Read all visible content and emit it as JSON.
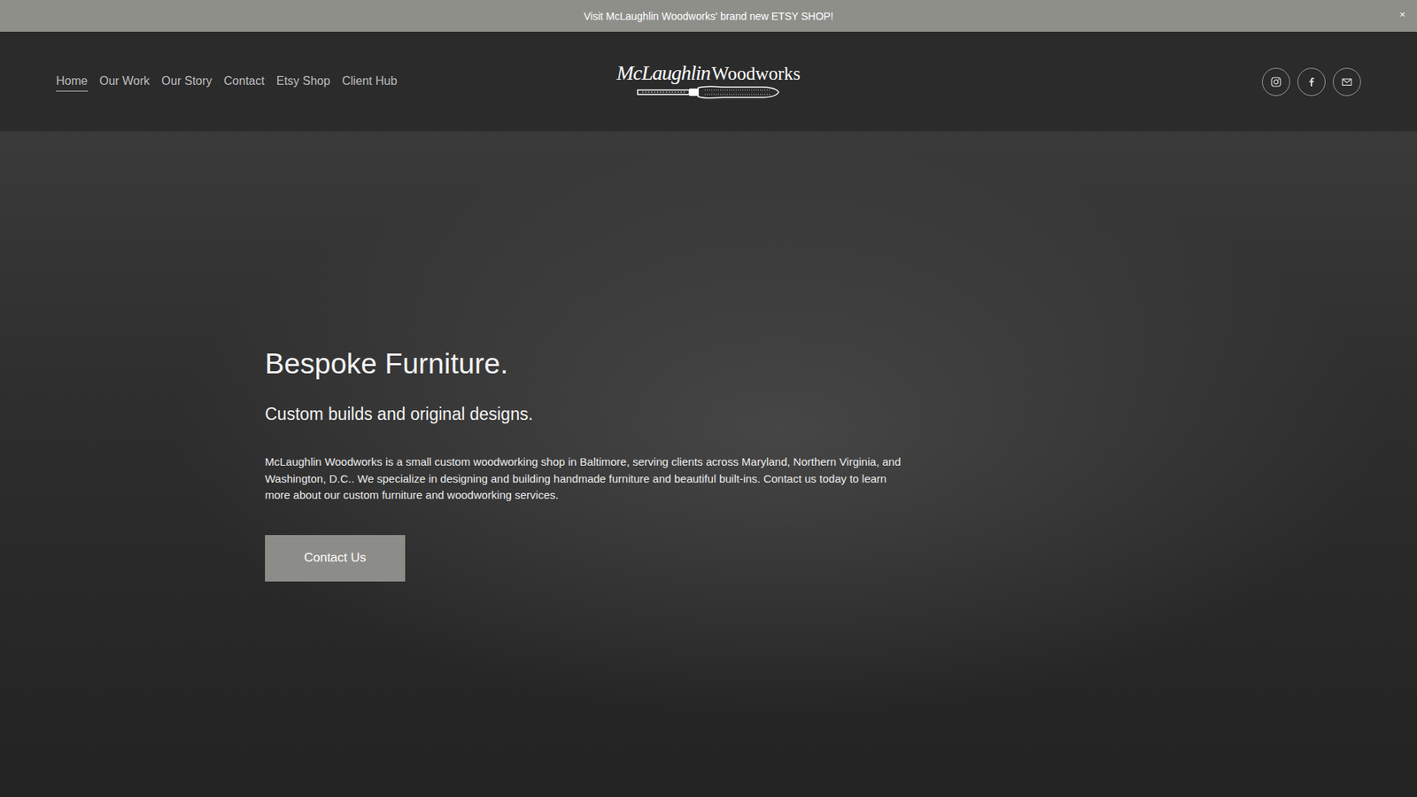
{
  "announcement": {
    "text": "Visit McLaughlin Woodworks' brand new ETSY SHOP!",
    "close": "×"
  },
  "nav": {
    "items": [
      {
        "label": "Home",
        "selected": true
      },
      {
        "label": "Our Work",
        "selected": false
      },
      {
        "label": "Our Story",
        "selected": false
      },
      {
        "label": "Contact",
        "selected": false
      },
      {
        "label": "Etsy Shop",
        "selected": false
      },
      {
        "label": "Client Hub",
        "selected": false
      }
    ]
  },
  "logo": {
    "script": "McLaughlin",
    "word": "Woodworks"
  },
  "hero": {
    "title": "Bespoke Furniture.",
    "subtitle": "Custom builds and original designs.",
    "body": "McLaughlin Woodworks is a small custom woodworking shop in Baltimore, serving clients across Maryland, Northern Virginia, and Washington, D.C.. We specialize in designing and building handmade furniture and beautiful built-ins. Contact us today to learn more about our custom furniture and woodworking services.",
    "button": "Contact Us"
  }
}
